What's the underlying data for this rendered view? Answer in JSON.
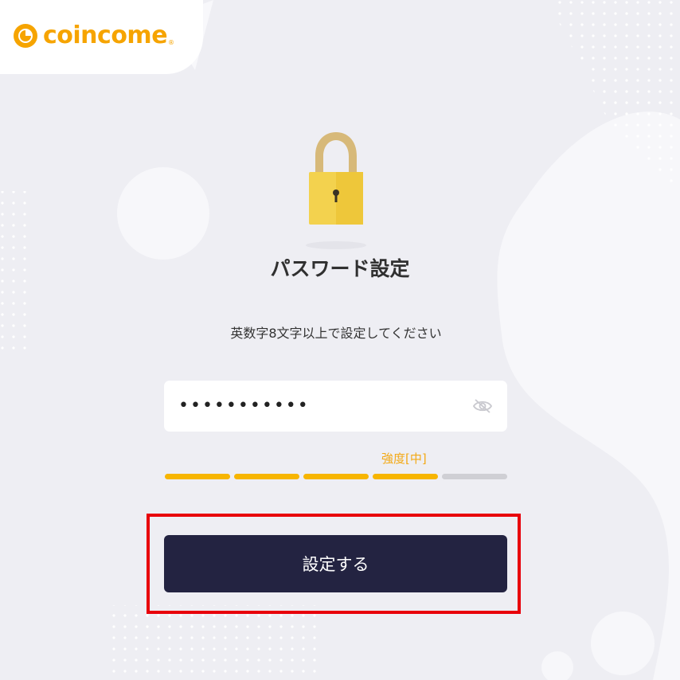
{
  "brand": {
    "name": "coincome",
    "reg_mark": "®",
    "color": "#f6a400"
  },
  "icons": {
    "logo": "coincome-logo-icon",
    "lock": "lock-icon",
    "eye": "eye-off-icon"
  },
  "page": {
    "title": "パスワード設定",
    "subtitle": "英数字8文字以上で設定してください"
  },
  "password": {
    "value": "•••••••••••",
    "toggle_icon": "eye-off-icon"
  },
  "strength": {
    "label": "強度[中]",
    "level": 4,
    "max": 5,
    "active_color": "#f7b500",
    "inactive_color": "#cfcfd4"
  },
  "actions": {
    "submit_label": "設定する"
  },
  "colors": {
    "button": "#232341",
    "highlight": "#e8000a",
    "background": "#eeeef3"
  }
}
